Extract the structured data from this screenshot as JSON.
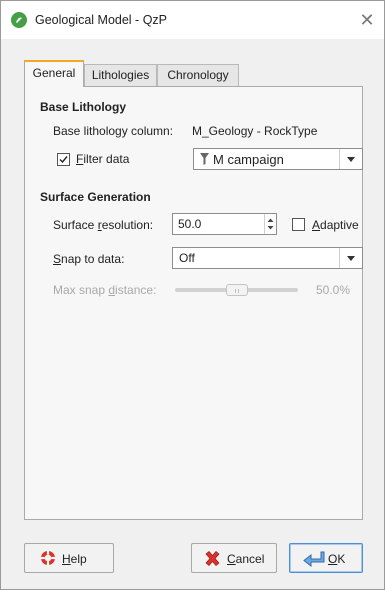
{
  "window": {
    "title": "Geological Model - QzP"
  },
  "tabs": [
    {
      "label": "General"
    },
    {
      "label": "Lithologies"
    },
    {
      "label": "Chronology"
    }
  ],
  "base_lithology": {
    "heading": "Base Lithology",
    "column_label": "Base lithology column:",
    "column_value": "M_Geology - RockType",
    "filter_label_first": "F",
    "filter_label_rest": "ilter data",
    "filter_checked": true,
    "filter_value": "M campaign"
  },
  "surface_generation": {
    "heading": "Surface Generation",
    "resolution_label_a": "Surface ",
    "resolution_label_u": "r",
    "resolution_label_b": "esolution:",
    "resolution_value": "50.0",
    "adaptive_label_first": "A",
    "adaptive_label_rest": "daptive",
    "adaptive_checked": false,
    "snap_label_first": "S",
    "snap_label_rest": "nap to data:",
    "snap_value": "Off",
    "max_snap_label_a": "Max snap ",
    "max_snap_label_u": "d",
    "max_snap_label_b": "istance:",
    "max_snap_percent": 50,
    "max_snap_value": "50.0%"
  },
  "footer": {
    "help_first": "H",
    "help_rest": "elp",
    "cancel_first": "C",
    "cancel_rest": "ancel",
    "ok_first": "O",
    "ok_rest": "K"
  }
}
